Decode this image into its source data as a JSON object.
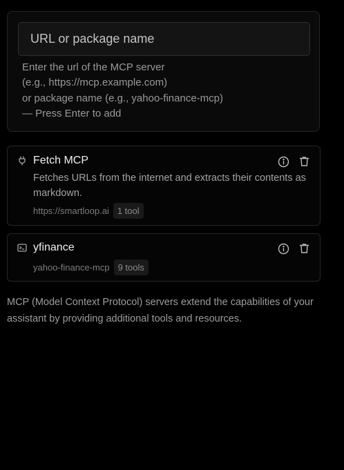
{
  "add_server": {
    "placeholder": "URL or package name",
    "value": "",
    "hint_lines": [
      "Enter the url of the MCP server",
      "(e.g., https://mcp.example.com)",
      "or package name (e.g., yahoo-finance-mcp)",
      "— Press Enter to add"
    ]
  },
  "servers": [
    {
      "name": "Fetch MCP",
      "icon": "plug-icon",
      "description": "Fetches URLs from the internet and extracts their contents as markdown.",
      "source": "https://smartloop.ai",
      "tools_badge": "1 tool",
      "actions": [
        "info-icon",
        "trash-icon"
      ]
    },
    {
      "name": "yfinance",
      "icon": "terminal-icon",
      "description": "",
      "source": "yahoo-finance-mcp",
      "tools_badge": "9 tools",
      "actions": [
        "info-icon",
        "trash-icon"
      ]
    }
  ],
  "footer_note": "MCP (Model Context Protocol) servers extend the capabilities of your assistant by providing additional tools and resources."
}
